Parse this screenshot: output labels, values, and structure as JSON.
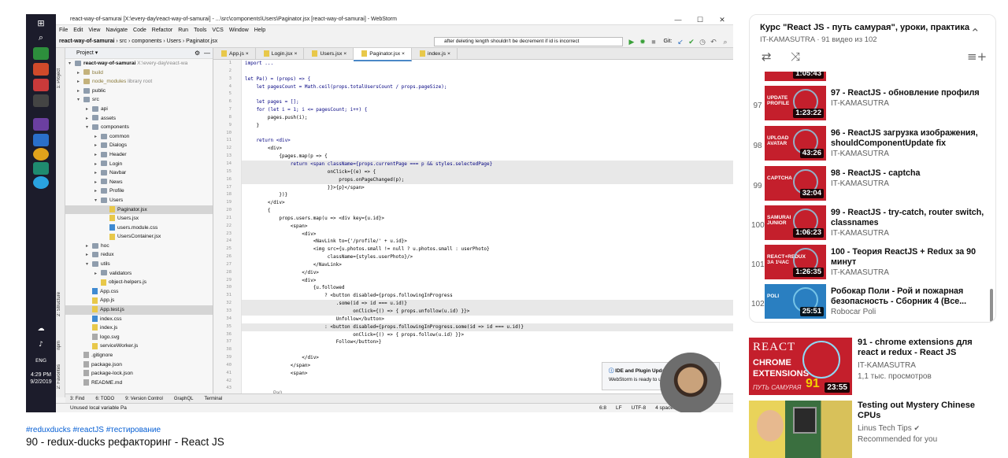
{
  "ide": {
    "title_text": "react-way-of-samurai [X:\\every-day\\react-way-of-samurai] - ...\\src\\components\\Users\\Paginator.jsx [react-way-of-samurai] - WebStorm",
    "menu": [
      "File",
      "Edit",
      "View",
      "Navigate",
      "Code",
      "Refactor",
      "Run",
      "Tools",
      "VCS",
      "Window",
      "Help"
    ],
    "breadcrumb": [
      "react-way-of-samurai",
      "src",
      "components",
      "Users",
      "Paginator.jsx"
    ],
    "run_config": "after deleting length shouldn't be decrement if id is incorrect",
    "git_label": "Git:",
    "project_label": "Project",
    "tabs": [
      "App.js",
      "Login.jsx",
      "Users.jsx",
      "Paginator.jsx",
      "index.js"
    ],
    "active_tab": "Paginator.jsx",
    "tree": [
      {
        "label": "react-way-of-samurai",
        "extra": "X:\\every-day\\react-wa",
        "indent": 0,
        "type": "folder",
        "bold": true
      },
      {
        "label": "build",
        "indent": 1,
        "type": "folder-y"
      },
      {
        "label": "node_modules",
        "extra": "library root",
        "indent": 1,
        "type": "folder-y"
      },
      {
        "label": "public",
        "indent": 1,
        "type": "folder"
      },
      {
        "label": "src",
        "indent": 1,
        "type": "folder"
      },
      {
        "label": "api",
        "indent": 2,
        "type": "folder"
      },
      {
        "label": "assets",
        "indent": 2,
        "type": "folder"
      },
      {
        "label": "components",
        "indent": 2,
        "type": "folder"
      },
      {
        "label": "common",
        "indent": 3,
        "type": "folder"
      },
      {
        "label": "Dialogs",
        "indent": 3,
        "type": "folder"
      },
      {
        "label": "Header",
        "indent": 3,
        "type": "folder"
      },
      {
        "label": "Login",
        "indent": 3,
        "type": "folder"
      },
      {
        "label": "Navbar",
        "indent": 3,
        "type": "folder"
      },
      {
        "label": "News",
        "indent": 3,
        "type": "folder"
      },
      {
        "label": "Profile",
        "indent": 3,
        "type": "folder"
      },
      {
        "label": "Users",
        "indent": 3,
        "type": "folder"
      },
      {
        "label": "Paginator.jsx",
        "indent": 4,
        "type": "js",
        "selected": true
      },
      {
        "label": "Users.jsx",
        "indent": 4,
        "type": "js"
      },
      {
        "label": "users.module.css",
        "indent": 4,
        "type": "css"
      },
      {
        "label": "UsersContainer.jsx",
        "indent": 4,
        "type": "js"
      },
      {
        "label": "hoc",
        "indent": 2,
        "type": "folder"
      },
      {
        "label": "redux",
        "indent": 2,
        "type": "folder"
      },
      {
        "label": "utils",
        "indent": 2,
        "type": "folder"
      },
      {
        "label": "validators",
        "indent": 3,
        "type": "folder"
      },
      {
        "label": "object-helpers.js",
        "indent": 3,
        "type": "js"
      },
      {
        "label": "App.css",
        "indent": 2,
        "type": "css"
      },
      {
        "label": "App.js",
        "indent": 2,
        "type": "js"
      },
      {
        "label": "App.test.js",
        "indent": 2,
        "type": "js",
        "selected": true
      },
      {
        "label": "index.css",
        "indent": 2,
        "type": "css"
      },
      {
        "label": "index.js",
        "indent": 2,
        "type": "js"
      },
      {
        "label": "logo.svg",
        "indent": 2,
        "type": "doc"
      },
      {
        "label": "serviceWorker.js",
        "indent": 2,
        "type": "js"
      },
      {
        "label": ".gitignore",
        "indent": 1,
        "type": "doc"
      },
      {
        "label": "package.json",
        "indent": 1,
        "type": "doc"
      },
      {
        "label": "package-lock.json",
        "indent": 1,
        "type": "doc"
      },
      {
        "label": "README.md",
        "indent": 1,
        "type": "doc"
      }
    ],
    "line_numbers": [
      "1",
      "2",
      "3",
      "4",
      "5",
      "6",
      "7",
      "8",
      "9",
      "10",
      "11",
      "12",
      "13",
      "14",
      "15",
      "16",
      "17",
      "18",
      "19",
      "20",
      "21",
      "22",
      "23",
      "24",
      "25",
      "26",
      "27",
      "28",
      "29",
      "30",
      "31",
      "32",
      "33",
      "34",
      "35",
      "36",
      "37",
      "38",
      "39",
      "40",
      "41",
      "42",
      "43"
    ],
    "code_lines": [
      "import ...",
      "",
      "let Pa() = (props) => {",
      "    let pagesCount = Math.ceil(props.totalUsersCount / props.pageSize);",
      "",
      "    let pages = [];",
      "    for (let i = 1; i <= pagesCount; i++) {",
      "        pages.push(i);",
      "    }",
      "",
      "    return <div>",
      "        <div>",
      "            {pages.map(p => {",
      "                return <span className={props.currentPage === p && styles.selectedPage}",
      "                             onClick={(e) => {",
      "                                 props.onPageChanged(p);",
      "                             }}>{p}</span>",
      "            })}",
      "        </div>",
      "        {",
      "            props.users.map(u => <div key={u.id}>",
      "                <span>",
      "                    <div>",
      "                        <NavLink to={'/profile/' + u.id}>",
      "                        <img src={u.photos.small != null ? u.photos.small : userPhoto}",
      "                             className={styles.userPhoto}/>",
      "                        </NavLink>",
      "                    </div>",
      "                    <div>",
      "                        {u.followed",
      "                            ? <button disabled={props.followingInProgress",
      "                                .some(id => id === u.id)}",
      "                                      onClick={() => { props.unfollow(u.id) }}>",
      "                                Unfollow</button>",
      "                            : <button disabled={props.followingInProgress.some(id => id === u.id)}",
      "                                      onClick={() => { props.follow(u.id) }}>",
      "                                Follow</button>}",
      "",
      "                    </div>",
      "                </span>",
      "                <span>",
      "",
      ""
    ],
    "crumb_bottom": "Pa()",
    "popup_title": "IDE and Plugin Updates",
    "popup_text": "WebStorm is ready to update.",
    "tool_strip": [
      "3: Find",
      "6: TODO",
      "9: Version Control",
      "GraphQL",
      "Terminal"
    ],
    "status_text": "Unused local variable Pa",
    "status_right": [
      "6:8",
      "LF",
      "UTF-8",
      "4 spaces"
    ],
    "side_labels": [
      "1: Project",
      "2: Structure",
      "npm",
      "2: Favorites"
    ],
    "taskbar": {
      "time": "4:29 PM",
      "date": "9/2/2019",
      "lang": "ENG"
    }
  },
  "video": {
    "hashtags": "#reduxducks #reactJS #тестирование",
    "title": "90 - redux-ducks рефакторинг - React JS"
  },
  "playlist": {
    "title": "Курс \"React JS - путь самурая\", уроки, практика",
    "subtitle": "IT-KAMASUTRA · 91 видео из 102",
    "items": [
      {
        "num": "",
        "title": "",
        "channel": "IT-KAMASUTRA",
        "duration": "1:05:43",
        "thumb_text": "FAQS",
        "two_line": false
      },
      {
        "num": "97",
        "title": "97 - ReactJS - обновление профиля",
        "channel": "IT-KAMASUTRA",
        "duration": "1:23:22",
        "thumb_text": "UPDATE PROFILE",
        "two_line": false
      },
      {
        "num": "98",
        "title": "96 - ReactJS загрузка изображения, shouldComponentUpdate fix",
        "channel": "IT-KAMASUTRA",
        "duration": "43:26",
        "thumb_text": "UPLOAD AVATAR",
        "two_line": true
      },
      {
        "num": "99",
        "title": "98 - ReactJS - captcha",
        "channel": "IT-KAMASUTRA",
        "duration": "32:04",
        "thumb_text": "CAPTCHA",
        "two_line": false
      },
      {
        "num": "100",
        "title": "99 - ReactJS - try-catch, router switch, classnames",
        "channel": "IT-KAMASUTRA",
        "duration": "1:06:23",
        "thumb_text": "SAMURAI JUNIOR",
        "two_line": true
      },
      {
        "num": "101",
        "title": "100 - Теория ReactJS + Redux за 90 минут",
        "channel": "IT-KAMASUTRA",
        "duration": "1:26:35",
        "thumb_text": "REACT+REDUX ЗА 1ЧАС",
        "two_line": true
      },
      {
        "num": "102",
        "title": "Робокар Поли - Рой и пожарная безопасность - Сборник 4 (Все...",
        "channel": "Robocar Poli",
        "duration": "25:51",
        "thumb_text": "POLI",
        "two_line": true
      }
    ]
  },
  "recommendations": [
    {
      "title": "91 - chrome extensions для react и redux - React JS",
      "channel": "IT-KAMASUTRA",
      "meta": "1,1 тыс. просмотров",
      "duration": "23:55",
      "thumb_lines": [
        "REACT",
        "CHROME",
        "EXTENSIONS"
      ],
      "thumb_footer": "ПУТЬ САМУРАЯ",
      "thumb_num": "91"
    },
    {
      "title": "Testing out Mystery Chinese CPUs",
      "channel": "Linus Tech Tips",
      "meta": "Recommended for you",
      "duration": "",
      "thumb_lines": [],
      "thumb_footer": "",
      "thumb_num": ""
    }
  ],
  "colors": {
    "accent_red": "#c41f2c",
    "link_blue": "#065fd4",
    "ide_tab_active": "#4a88c7"
  }
}
